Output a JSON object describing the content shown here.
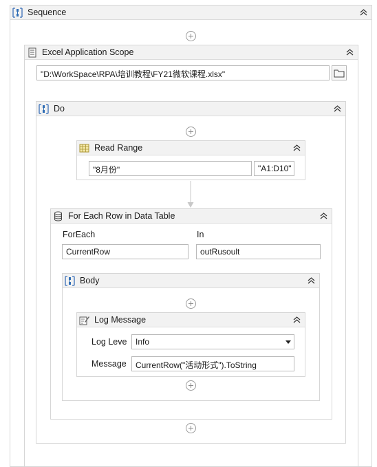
{
  "sequence": {
    "title": "Sequence",
    "icon": "sequence-icon"
  },
  "excel_scope": {
    "title": "Excel Application Scope",
    "icon": "excel-scope-icon",
    "path": "\"D:\\WorkSpace\\RPA\\培训教程\\FY21微软课程.xlsx\"",
    "browse_icon": "folder-icon"
  },
  "do": {
    "title": "Do",
    "icon": "sequence-icon"
  },
  "read_range": {
    "title": "Read Range",
    "icon": "read-range-icon",
    "sheet": "\"8月份\"",
    "range": "\"A1:D10\""
  },
  "for_each": {
    "title": "For Each Row in Data Table",
    "icon": "database-icon",
    "foreach_label": "ForEach",
    "in_label": "In",
    "foreach_value": "CurrentRow",
    "in_value": "outRusoult"
  },
  "body": {
    "title": "Body",
    "icon": "sequence-icon"
  },
  "log_message": {
    "title": "Log Message",
    "icon": "log-message-icon",
    "level_label": "Log Leve",
    "level_value": "Info",
    "message_label": "Message",
    "message_value": "CurrentRow(\"活动形式\").ToString"
  },
  "colors": {
    "accent_blue": "#2f6db5",
    "header_bg": "#f2f2f2",
    "border": "#d6d6d6"
  }
}
